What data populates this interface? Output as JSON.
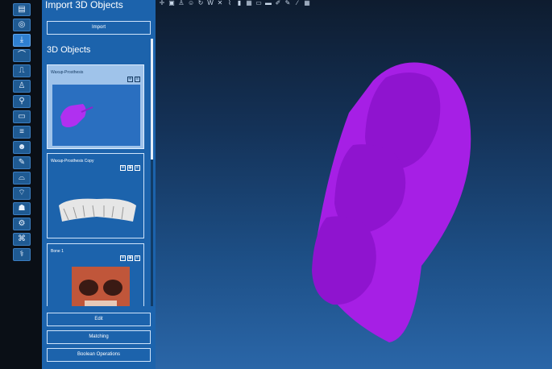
{
  "panel": {
    "title": "Import 3D Objects",
    "import_button": "Import",
    "section_title": "3D Objects",
    "objects": [
      {
        "name": "Waxup-Prosthesis",
        "selected": true
      },
      {
        "name": "Waxup-Prosthesis Copy",
        "selected": false
      },
      {
        "name": "Bone 1",
        "selected": false
      }
    ],
    "buttons": {
      "edit": "Edit",
      "matching": "Matching",
      "boolean": "Boolean Operations"
    }
  },
  "colors": {
    "accent": "#1c63ac",
    "model": "#a020f0",
    "rail": "#0a0f16"
  },
  "rail_icons": [
    "import-file-icon",
    "scan-icon",
    "download-icon",
    "arch-curve-icon",
    "panorama-icon",
    "tooth-icon",
    "implant-icon",
    "report-icon",
    "edit-list-icon",
    "face-icon",
    "wand-icon",
    "mandible-icon",
    "maxilla-icon",
    "segment-icon",
    "gear-box-icon",
    "tree-icon",
    "nerve-icon"
  ],
  "toolbar_icons": [
    "move-icon",
    "view-box-icon",
    "tooth-view-icon",
    "head-view-icon",
    "rotate-icon",
    "wireframe-icon",
    "close-icon",
    "ruler-icon",
    "pin-icon",
    "grid-view-icon",
    "layers-icon",
    "screen-icon",
    "brush-icon",
    "pen-icon",
    "line-icon",
    "grid-icon"
  ]
}
